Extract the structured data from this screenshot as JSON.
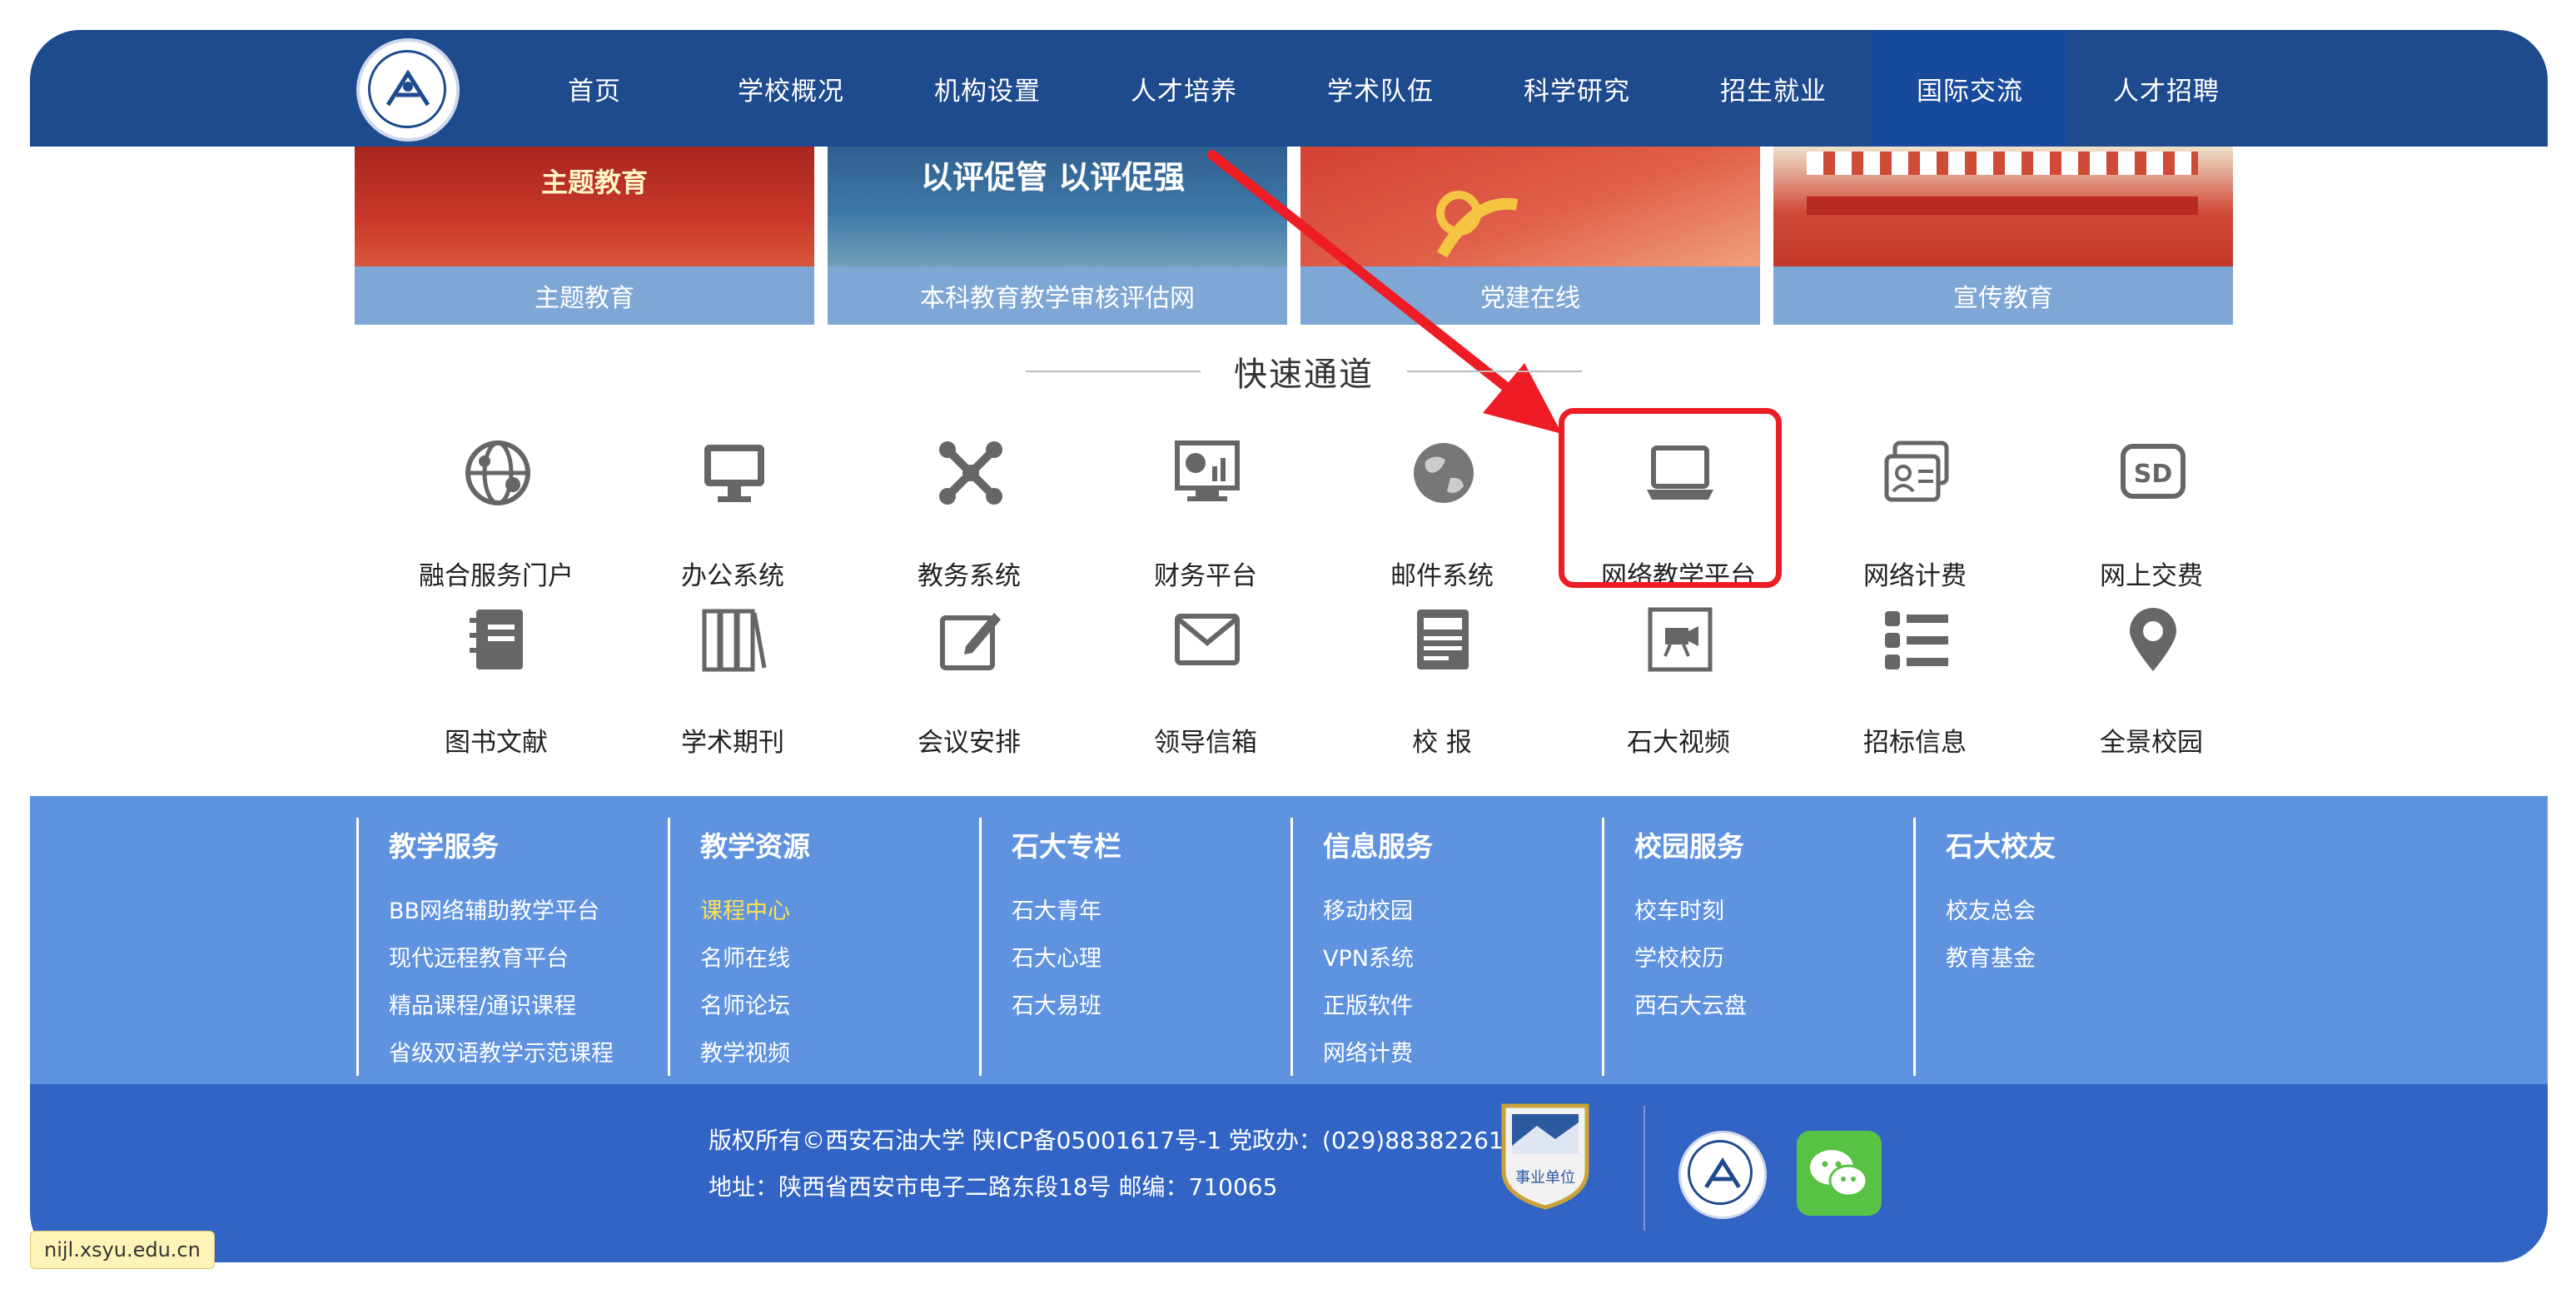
{
  "nav": {
    "items": [
      {
        "label": "首页"
      },
      {
        "label": "学校概况"
      },
      {
        "label": "机构设置"
      },
      {
        "label": "人才培养"
      },
      {
        "label": "学术队伍"
      },
      {
        "label": "科学研究"
      },
      {
        "label": "招生就业"
      },
      {
        "label": "国际交流"
      },
      {
        "label": "人才招聘"
      }
    ],
    "active": "国际交流"
  },
  "banners": [
    {
      "caption": "主题教育",
      "image_text": "主题教育"
    },
    {
      "caption": "本科教育教学审核评估网",
      "image_text": "以评促管  以评促强"
    },
    {
      "caption": "党建在线",
      "image_text": ""
    },
    {
      "caption": "宣传教育",
      "image_text": ""
    }
  ],
  "quick_access": {
    "title": "快速通道",
    "items": [
      {
        "label": "融合服务门户",
        "icon": "globe-network-icon"
      },
      {
        "label": "办公系统",
        "icon": "monitor-icon"
      },
      {
        "label": "教务系统",
        "icon": "molecule-icon"
      },
      {
        "label": "财务平台",
        "icon": "chart-screen-icon"
      },
      {
        "label": "邮件系统",
        "icon": "globe-icon"
      },
      {
        "label": "网络教学平台",
        "icon": "laptop-icon"
      },
      {
        "label": "网络计费",
        "icon": "id-card-icon"
      },
      {
        "label": "网上交费",
        "icon": "sd-card-icon"
      },
      {
        "label": "图书文献",
        "icon": "notebook-icon"
      },
      {
        "label": "学术期刊",
        "icon": "books-icon"
      },
      {
        "label": "会议安排",
        "icon": "edit-icon"
      },
      {
        "label": "领导信箱",
        "icon": "mail-icon"
      },
      {
        "label": "校 报",
        "icon": "newspaper-icon"
      },
      {
        "label": "石大视频",
        "icon": "video-camera-icon"
      },
      {
        "label": "招标信息",
        "icon": "list-icon"
      },
      {
        "label": "全景校园",
        "icon": "map-pin-icon"
      }
    ],
    "highlighted": "网络教学平台"
  },
  "footer_links": [
    {
      "heading": "教学服务",
      "links": [
        "BB网络辅助教学平台",
        "现代远程教育平台",
        "精品课程/通识课程",
        "省级双语教学示范课程"
      ]
    },
    {
      "heading": "教学资源",
      "links": [
        "课程中心",
        "名师在线",
        "名师论坛",
        "教学视频"
      ],
      "highlight": "课程中心"
    },
    {
      "heading": "石大专栏",
      "links": [
        "石大青年",
        "石大心理",
        "石大易班"
      ]
    },
    {
      "heading": "信息服务",
      "links": [
        "移动校园",
        "VPN系统",
        "正版软件",
        "网络计费"
      ]
    },
    {
      "heading": "校园服务",
      "links": [
        "校车时刻",
        "学校校历",
        "西石大云盘"
      ]
    },
    {
      "heading": "石大校友",
      "links": [
        "校友总会",
        "教育基金"
      ]
    }
  ],
  "copyright": {
    "line1": "版权所有©西安石油大学 陕ICP备05001617号-1 党政办：(029)88382261",
    "line2": "地址：陕西省西安市电子二路东段18号 邮编：710065",
    "badge_text": "事业单位"
  },
  "status_url": "nijl.xsyu.edu.cn",
  "colors": {
    "nav_bg": "#1e4a8e",
    "links_bg": "#5f93e0",
    "copyright_bg": "#3264c5",
    "highlight_box": "#ee1c24",
    "link_highlight": "#ffe14f"
  }
}
